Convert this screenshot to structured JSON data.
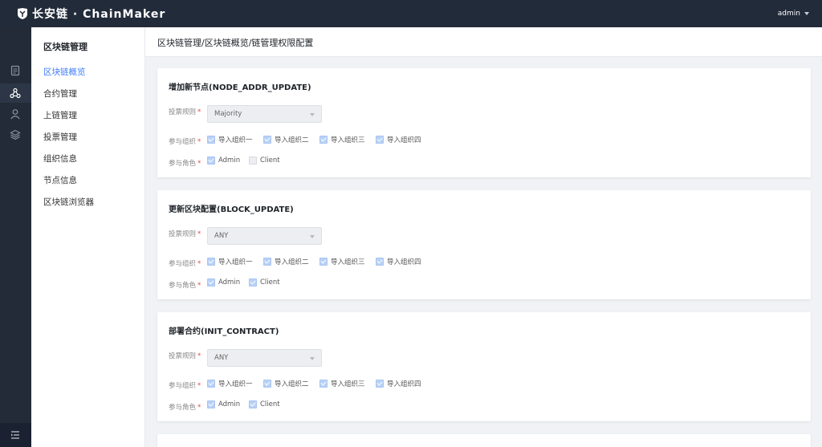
{
  "header": {
    "brand": "长安链 · ChainMaker",
    "user": "admin"
  },
  "rail": {
    "icons": [
      "document-icon",
      "network-icon",
      "user-icon",
      "layers-icon",
      "collapse-menu-icon"
    ]
  },
  "sidebar": {
    "title": "区块链管理",
    "items": [
      {
        "label": "区块链概览",
        "active": true
      },
      {
        "label": "合约管理",
        "active": false
      },
      {
        "label": "上链管理",
        "active": false
      },
      {
        "label": "投票管理",
        "active": false
      },
      {
        "label": "组织信息",
        "active": false
      },
      {
        "label": "节点信息",
        "active": false
      },
      {
        "label": "区块链浏览器",
        "active": false
      }
    ]
  },
  "breadcrumb": "区块链管理/区块链概览/链管理权限配置",
  "labels": {
    "vote_rule": "投票规则",
    "orgs": "参与组织",
    "roles": "参与角色",
    "required_mark": "*"
  },
  "cards": [
    {
      "title": "增加新节点(NODE_ADDR_UPDATE)",
      "rule": "Majority",
      "orgs": [
        {
          "label": "导入组织一",
          "checked": true
        },
        {
          "label": "导入组织二",
          "checked": true
        },
        {
          "label": "导入组织三",
          "checked": true
        },
        {
          "label": "导入组织四",
          "checked": true
        }
      ],
      "roles": [
        {
          "label": "Admin",
          "checked": true
        },
        {
          "label": "Client",
          "checked": false
        }
      ]
    },
    {
      "title": "更新区块配置(BLOCK_UPDATE)",
      "rule": "ANY",
      "orgs": [
        {
          "label": "导入组织一",
          "checked": true
        },
        {
          "label": "导入组织二",
          "checked": true
        },
        {
          "label": "导入组织三",
          "checked": true
        },
        {
          "label": "导入组织四",
          "checked": true
        }
      ],
      "roles": [
        {
          "label": "Admin",
          "checked": true
        },
        {
          "label": "Client",
          "checked": true
        }
      ]
    },
    {
      "title": "部署合约(INIT_CONTRACT)",
      "rule": "ANY",
      "orgs": [
        {
          "label": "导入组织一",
          "checked": true
        },
        {
          "label": "导入组织二",
          "checked": true
        },
        {
          "label": "导入组织三",
          "checked": true
        },
        {
          "label": "导入组织四",
          "checked": true
        }
      ],
      "roles": [
        {
          "label": "Admin",
          "checked": true
        },
        {
          "label": "Client",
          "checked": true
        }
      ]
    }
  ],
  "colors": {
    "header_bg": "#222b3a",
    "accent": "#3e7bfa",
    "required": "#e8474d"
  }
}
